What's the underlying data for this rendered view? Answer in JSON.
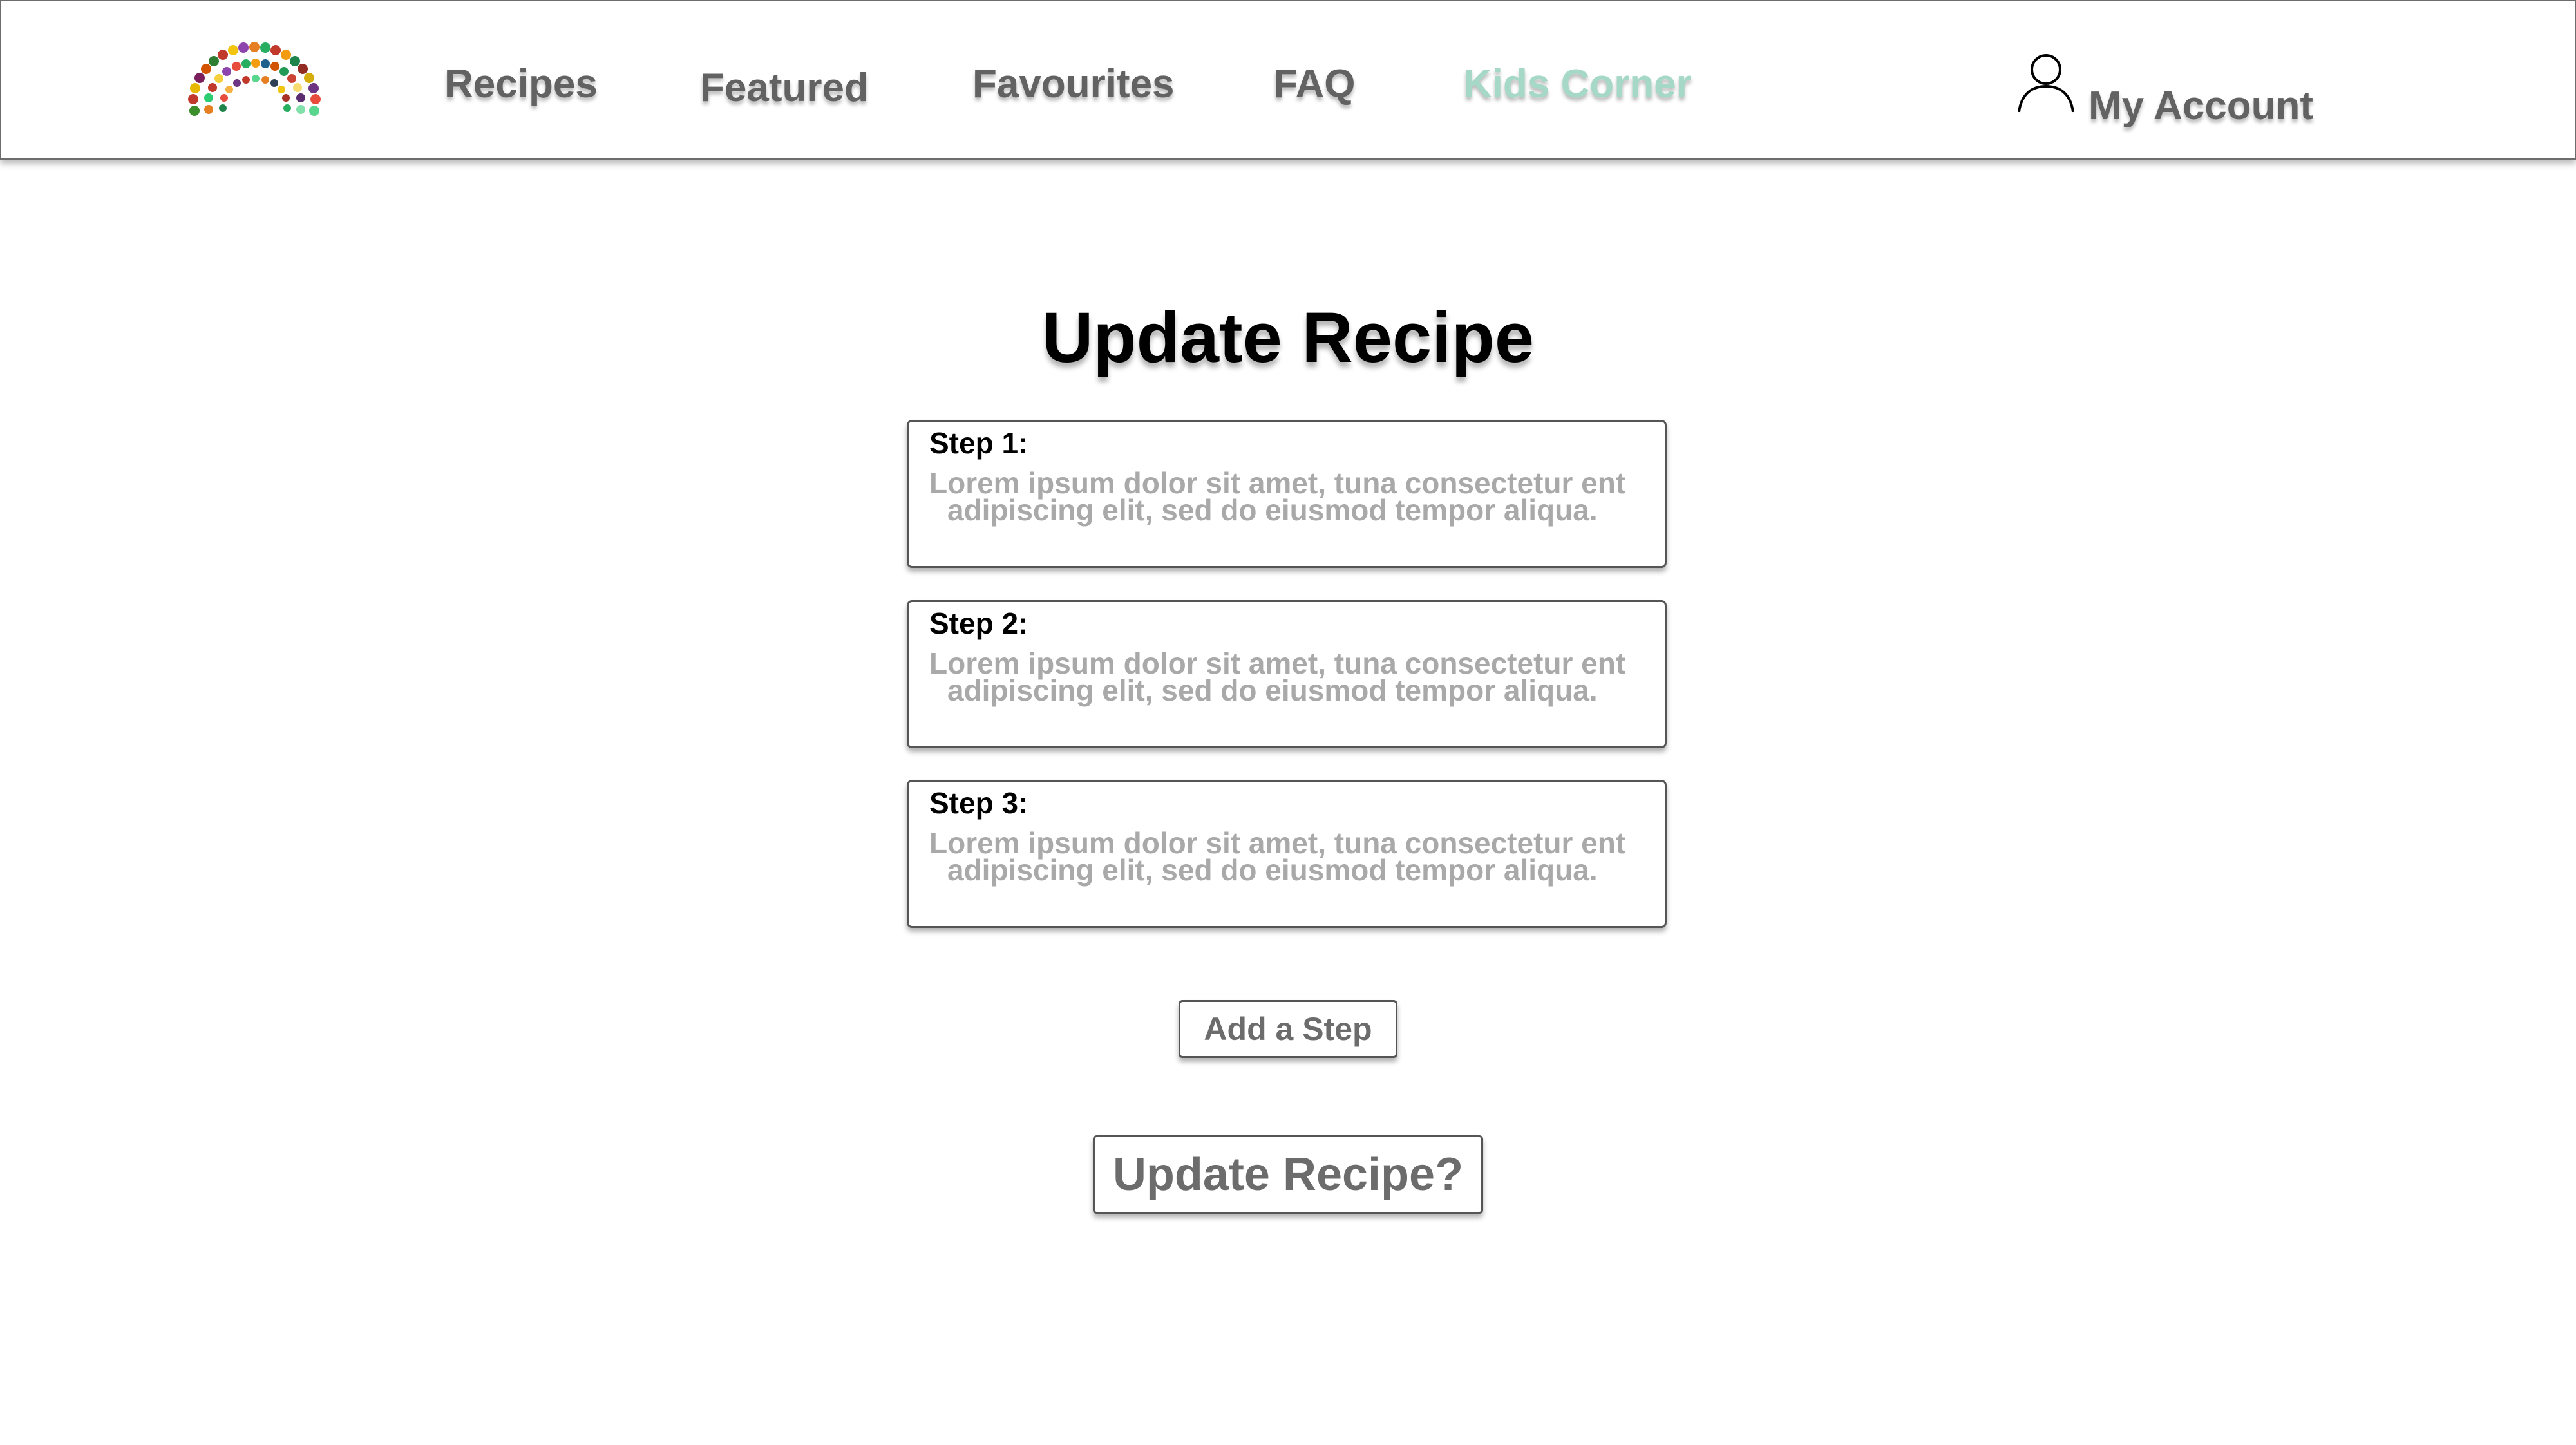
{
  "nav": {
    "logo_icon": "vegetable-rainbow-logo",
    "items": [
      {
        "label": "Recipes"
      },
      {
        "label": "Featured"
      },
      {
        "label": "Favourites"
      },
      {
        "label": "FAQ"
      },
      {
        "label": "Kids Corner"
      }
    ],
    "account_label": "My Account",
    "account_icon": "user-icon",
    "accent_color": "#a5d8c6",
    "link_color": "#626262"
  },
  "main": {
    "title": "Update Recipe",
    "steps": [
      {
        "label": "Step 1:",
        "line1": "Lorem ipsum dolor sit amet, tuna consectetur ent",
        "line2": "adipiscing elit, sed do eiusmod tempor aliqua."
      },
      {
        "label": "Step 2:",
        "line1": "Lorem ipsum dolor sit amet, tuna consectetur ent",
        "line2": "adipiscing elit, sed do eiusmod tempor aliqua."
      },
      {
        "label": "Step 3:",
        "line1": "Lorem ipsum dolor sit amet, tuna consectetur ent",
        "line2": "adipiscing elit, sed do eiusmod tempor aliqua."
      }
    ],
    "add_step_label": "Add a Step",
    "update_label": "Update Recipe?"
  }
}
